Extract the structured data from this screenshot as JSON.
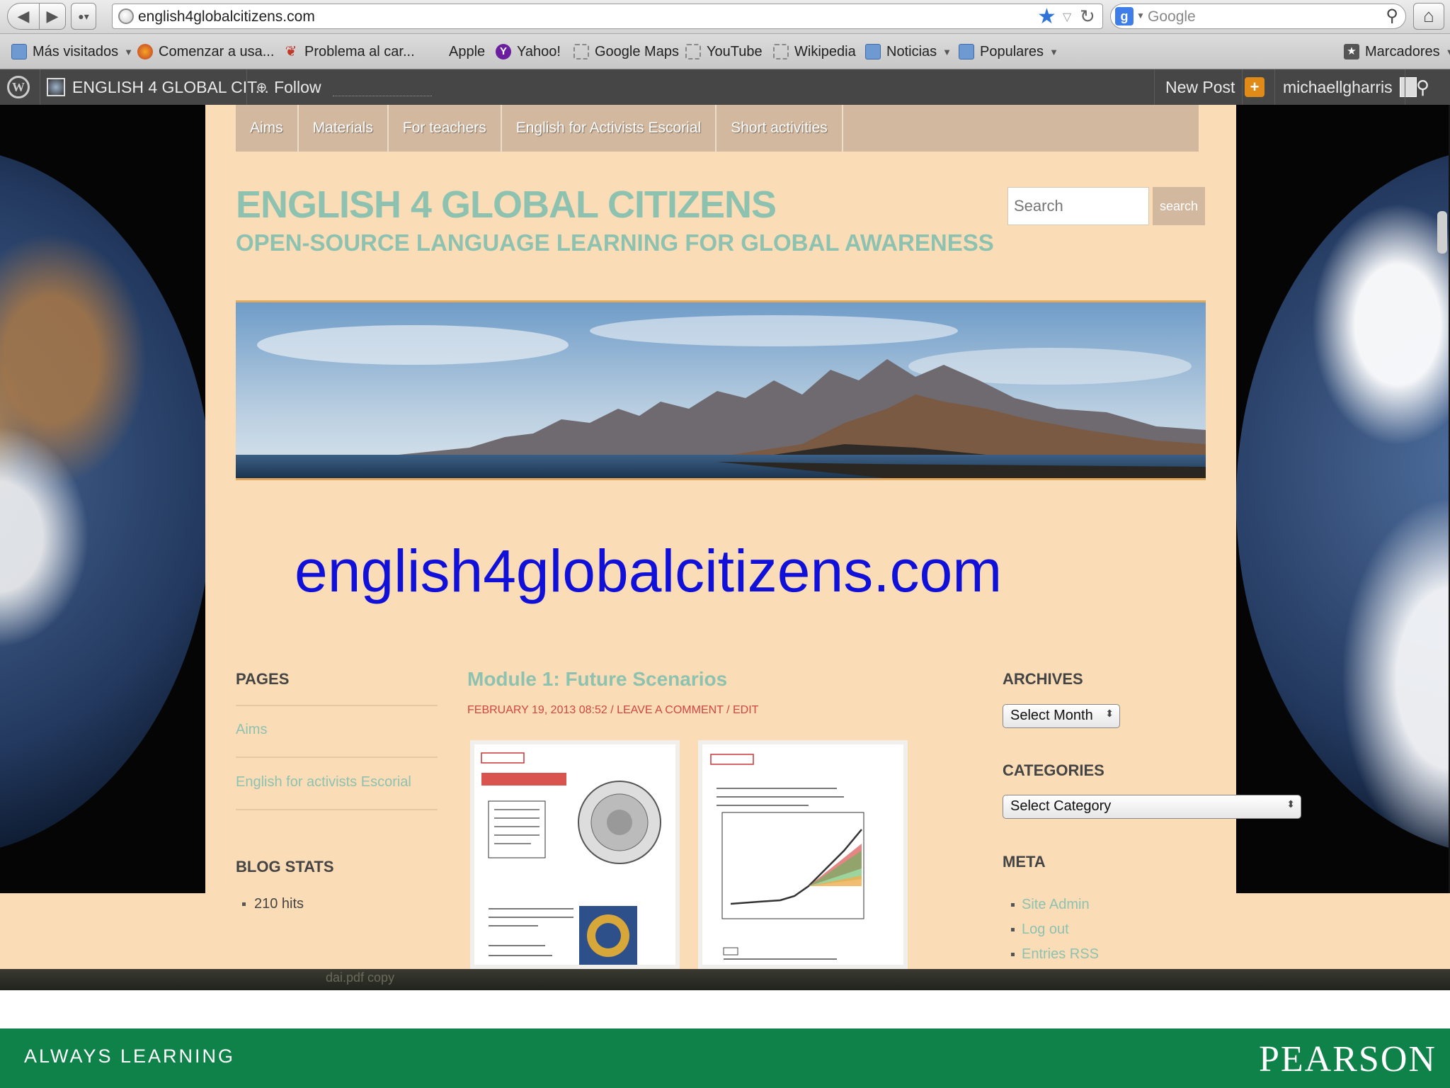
{
  "browser": {
    "url": "english4globalcitizens.com",
    "search_engine": "Google",
    "bookmarks": [
      {
        "label": "Más visitados",
        "icon": "folder-icon",
        "dropdown": true
      },
      {
        "label": "Comenzar a usa...",
        "icon": "firefox-icon",
        "dropdown": false
      },
      {
        "label": "Problema al car...",
        "icon": "puzzle-icon",
        "dropdown": false
      },
      {
        "label": "Apple",
        "icon": "apple-icon",
        "dropdown": false
      },
      {
        "label": "Yahoo!",
        "icon": "yahoo-icon",
        "dropdown": false
      },
      {
        "label": "Google Maps",
        "icon": "dashed-page-icon",
        "dropdown": false
      },
      {
        "label": "YouTube",
        "icon": "dashed-page-icon",
        "dropdown": false
      },
      {
        "label": "Wikipedia",
        "icon": "dashed-page-icon",
        "dropdown": false
      },
      {
        "label": "Noticias",
        "icon": "folder-icon",
        "dropdown": true
      },
      {
        "label": "Populares",
        "icon": "folder-icon",
        "dropdown": true
      }
    ],
    "bookmarks_menu": "Marcadores"
  },
  "wpbar": {
    "site_name": "ENGLISH 4 GLOBAL CIT...",
    "follow": "Follow",
    "new_post": "New Post",
    "username": "michaellgharris"
  },
  "site": {
    "menu": [
      "Aims",
      "Materials",
      "For teachers",
      "English for Activists Escorial",
      "Short activities"
    ],
    "title": "ENGLISH 4 GLOBAL CITIZENS",
    "tagline": "OPEN-SOURCE LANGUAGE LEARNING FOR GLOBAL AWARENESS",
    "search_placeholder": "Search",
    "search_button": "search",
    "big_url": "english4globalcitizens.com"
  },
  "sidebar_left": {
    "pages_title": "PAGES",
    "pages": [
      "Aims",
      "English for activists Escorial"
    ],
    "stats_title": "BLOG STATS",
    "stats": "210 hits"
  },
  "post": {
    "title": "Module 1: Future Scenarios",
    "meta": "FEBRUARY 19, 2013 08:52 / LEAVE A COMMENT / EDIT"
  },
  "sidebar_right": {
    "archives_title": "ARCHIVES",
    "archives_select": "Select Month",
    "categories_title": "CATEGORIES",
    "categories_select": "Select Category",
    "meta_title": "META",
    "meta_links": [
      "Site Admin",
      "Log out",
      "Entries RSS"
    ]
  },
  "footer": {
    "left": "ALWAYS LEARNING",
    "right": "PEARSON"
  },
  "colors": {
    "page_bg": "#fadcb6",
    "accent_teal": "#8ec2b0",
    "menu_bg": "#d2b89f",
    "link_blue": "#1010d8",
    "footer_green": "#0e8249"
  }
}
